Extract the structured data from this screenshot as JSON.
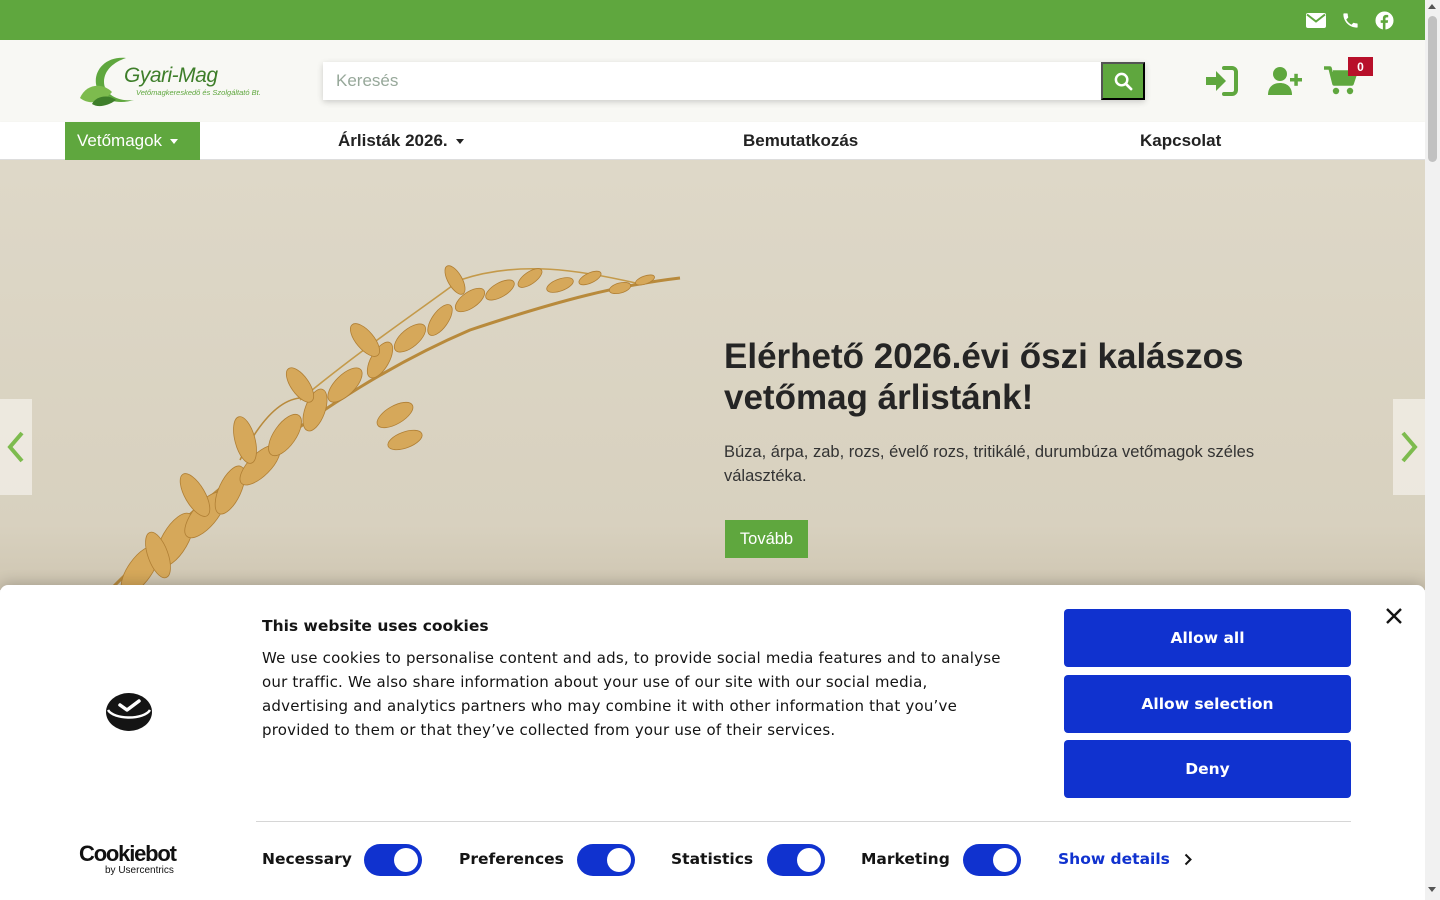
{
  "brand": {
    "name": "Gyari-Mag",
    "tagline": "Vetőmagkereskedő és Szolgáltató Bt."
  },
  "colors": {
    "green": "#5fa73e",
    "cookie_blue": "#1032cf",
    "badge_red": "#b8102a"
  },
  "topbar": {
    "icons": [
      "envelope-icon",
      "phone-icon",
      "facebook-icon"
    ]
  },
  "search": {
    "placeholder": "Keresés",
    "value": ""
  },
  "header": {
    "icons": [
      "login-icon",
      "register-user-icon",
      "cart-icon"
    ],
    "cart_count": "0"
  },
  "nav": {
    "items": [
      {
        "label": "Vetőmagok",
        "has_dropdown": true,
        "active": true
      },
      {
        "label": "Árlisták 2026.",
        "has_dropdown": true,
        "active": false
      },
      {
        "label": "Bemutatkozás",
        "has_dropdown": false,
        "active": false
      },
      {
        "label": "Kapcsolat",
        "has_dropdown": false,
        "active": false
      }
    ]
  },
  "hero": {
    "title": "Elérhető 2026.évi őszi kalászos vetőmag árlistánk!",
    "text": "Búza, árpa, zab, rozs, évelő rozs, tritikálé, durumbúza vetőmagok széles választéka.",
    "button": "Tovább"
  },
  "cookie": {
    "title": "This website uses cookies",
    "text": "We use cookies to personalise content and ads, to provide social media features and to analyse our traffic. We also share information about your use of our site with our social media, advertising and analytics partners who may combine it with other information that you’ve provided to them or that they’ve collected from your use of their services.",
    "buttons": {
      "allow_all": "Allow all",
      "allow_selection": "Allow selection",
      "deny": "Deny"
    },
    "toggles": [
      {
        "label": "Necessary",
        "on": true
      },
      {
        "label": "Preferences",
        "on": true
      },
      {
        "label": "Statistics",
        "on": true
      },
      {
        "label": "Marketing",
        "on": true
      }
    ],
    "show_details": "Show details",
    "provider": {
      "name": "Cookiebot",
      "by": "by Usercentrics"
    }
  }
}
